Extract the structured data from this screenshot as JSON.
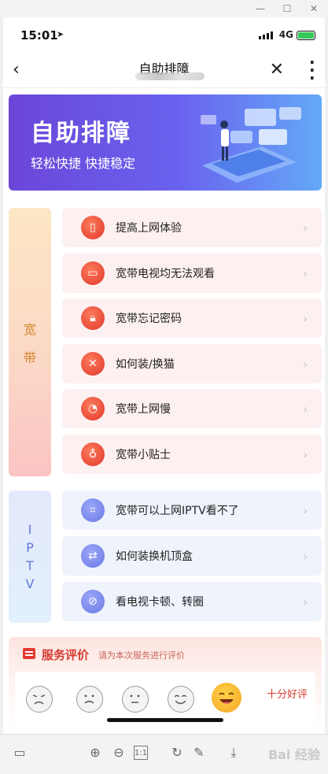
{
  "status": {
    "time": "15:01",
    "network": "4G"
  },
  "nav": {
    "title": "自助排障"
  },
  "banner": {
    "title": "自助排障",
    "subtitle": "轻松快捷 快捷稳定"
  },
  "broadband": {
    "side_label": [
      "宽",
      "带"
    ],
    "items": [
      {
        "label": "提高上网体验",
        "icon": "phone-icon"
      },
      {
        "label": "宽带电视均无法观看",
        "icon": "tv-icon"
      },
      {
        "label": "宽带忘记密码",
        "icon": "lock-icon"
      },
      {
        "label": "如何装/换猫",
        "icon": "tools-icon"
      },
      {
        "label": "宽带上网慢",
        "icon": "speedometer-icon"
      },
      {
        "label": "宽带小贴士",
        "icon": "lightbulb-icon"
      }
    ]
  },
  "iptv": {
    "side_label": [
      "I",
      "P",
      "T",
      "V"
    ],
    "items": [
      {
        "label": "宽带可以上网IPTV看不了",
        "icon": "scan-icon"
      },
      {
        "label": "如何装换机顶盒",
        "icon": "swap-icon"
      },
      {
        "label": "看电视卡顿、转圈",
        "icon": "eye-off-icon"
      }
    ]
  },
  "rating": {
    "title": "服务评价",
    "subtitle": "请为本次服务进行评价",
    "selected_label": "十分好评",
    "faces": [
      "angry-face-icon",
      "sad-face-icon",
      "neutral-face-icon",
      "smile-face-icon",
      "happy-face-icon"
    ],
    "selected_index": 4
  },
  "toolbar": {
    "zoom_reset": "1:1",
    "watermark": "Bai 经验"
  },
  "colors": {
    "accent": "#e23a32",
    "banner_start": "#6b46d8",
    "banner_end": "#63a9f7",
    "iptv_accent": "#6a79e6"
  }
}
